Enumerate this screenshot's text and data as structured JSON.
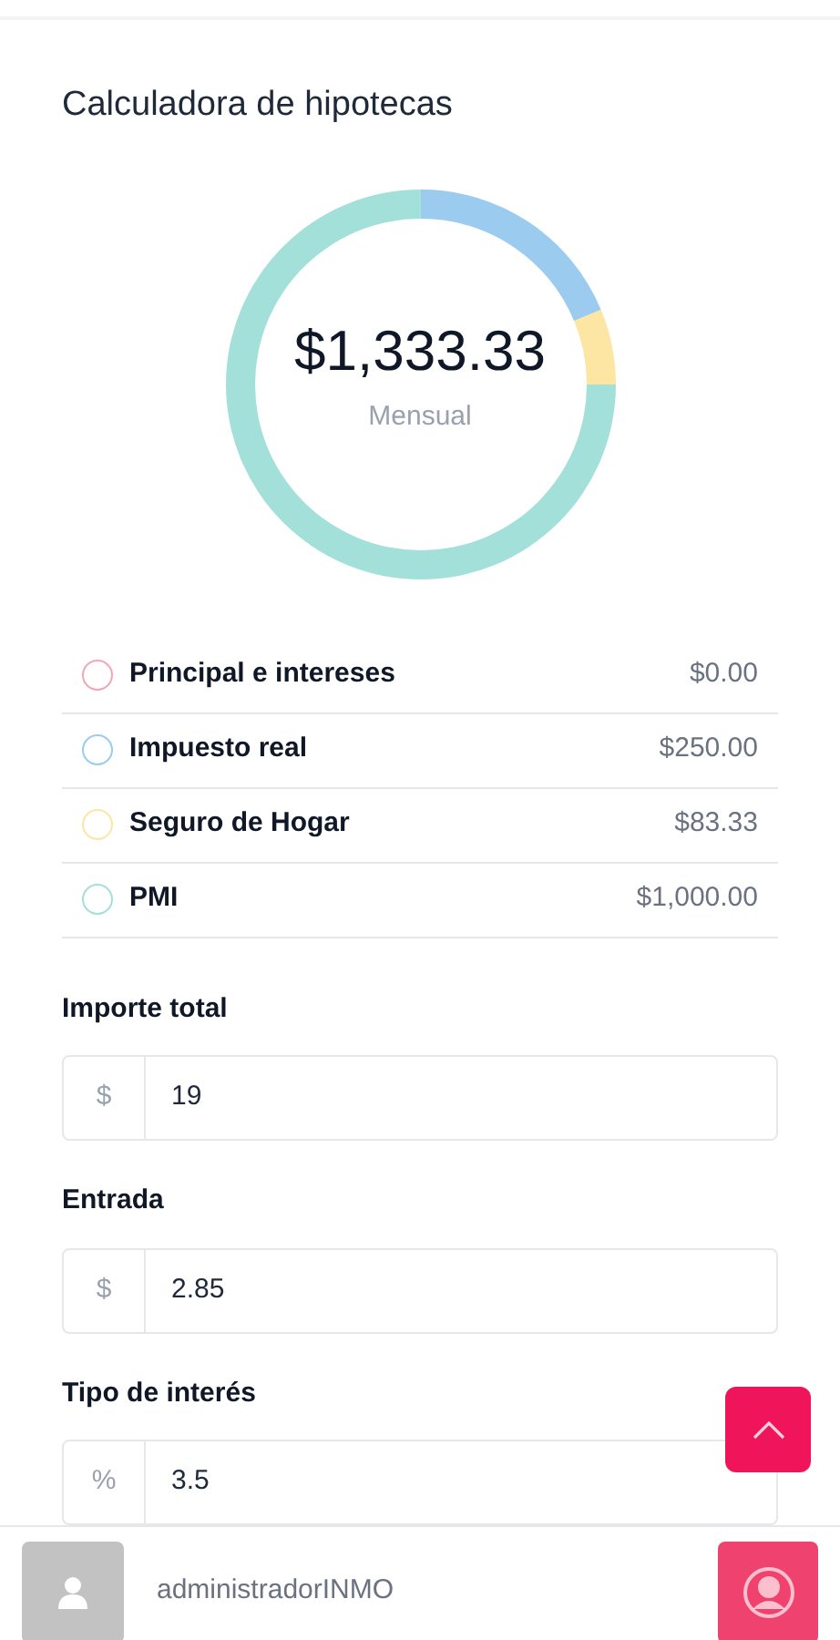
{
  "title": "Calculadora de hipotecas",
  "summary": {
    "amount": "$1,333.33",
    "period": "Mensual"
  },
  "legend": [
    {
      "label": "Principal e intereses",
      "value": "$0.00",
      "color": "#f2a7b8"
    },
    {
      "label": "Impuesto real",
      "value": "$250.00",
      "color": "#9ccbf0"
    },
    {
      "label": "Seguro de Hogar",
      "value": "$83.33",
      "color": "#fde6a4"
    },
    {
      "label": "PMI",
      "value": "$1,000.00",
      "color": "#a3e0da"
    }
  ],
  "fields": [
    {
      "label": "Importe total",
      "prefix": "$",
      "value": "19"
    },
    {
      "label": "Entrada",
      "prefix": "$",
      "value": "2.85"
    },
    {
      "label": "Tipo de interés",
      "prefix": "%",
      "value": "3.5"
    }
  ],
  "user": {
    "name": "administradorINMO"
  }
}
